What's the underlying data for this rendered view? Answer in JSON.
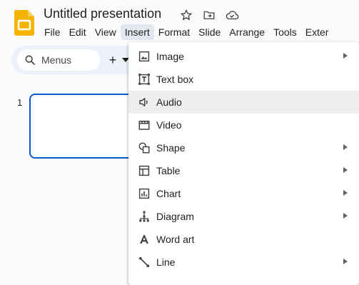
{
  "app": {
    "title": "Untitled presentation",
    "logo_icon": "google-slides-logo",
    "brand_color": "#f4b400"
  },
  "title_icons": [
    "star-icon",
    "move-to-folder-icon",
    "cloud-saved-icon"
  ],
  "menubar": [
    {
      "label": "File"
    },
    {
      "label": "Edit"
    },
    {
      "label": "View"
    },
    {
      "label": "Insert",
      "active": true
    },
    {
      "label": "Format"
    },
    {
      "label": "Slide"
    },
    {
      "label": "Arrange"
    },
    {
      "label": "Tools"
    },
    {
      "label": "Exter"
    }
  ],
  "toolbar": {
    "search_label": "Menus",
    "new_slide_label": "+"
  },
  "filmstrip": {
    "slide_number": "1"
  },
  "insert_menu": {
    "items": [
      {
        "label": "Image",
        "icon": "image-icon",
        "submenu": true
      },
      {
        "label": "Text box",
        "icon": "text-box-icon",
        "submenu": false
      },
      {
        "label": "Audio",
        "icon": "audio-icon",
        "submenu": false,
        "hovered": true
      },
      {
        "label": "Video",
        "icon": "video-icon",
        "submenu": false
      },
      {
        "label": "Shape",
        "icon": "shape-icon",
        "submenu": true
      },
      {
        "label": "Table",
        "icon": "table-icon",
        "submenu": true
      },
      {
        "label": "Chart",
        "icon": "chart-icon",
        "submenu": true
      },
      {
        "label": "Diagram",
        "icon": "diagram-icon",
        "submenu": true
      },
      {
        "label": "Word art",
        "icon": "word-art-icon",
        "submenu": false
      },
      {
        "label": "Line",
        "icon": "line-icon",
        "submenu": true
      }
    ]
  },
  "colors": {
    "selection_blue": "#0b57d0",
    "active_menu_bg": "#e2e7f0",
    "hover_bg": "#edeef0"
  }
}
